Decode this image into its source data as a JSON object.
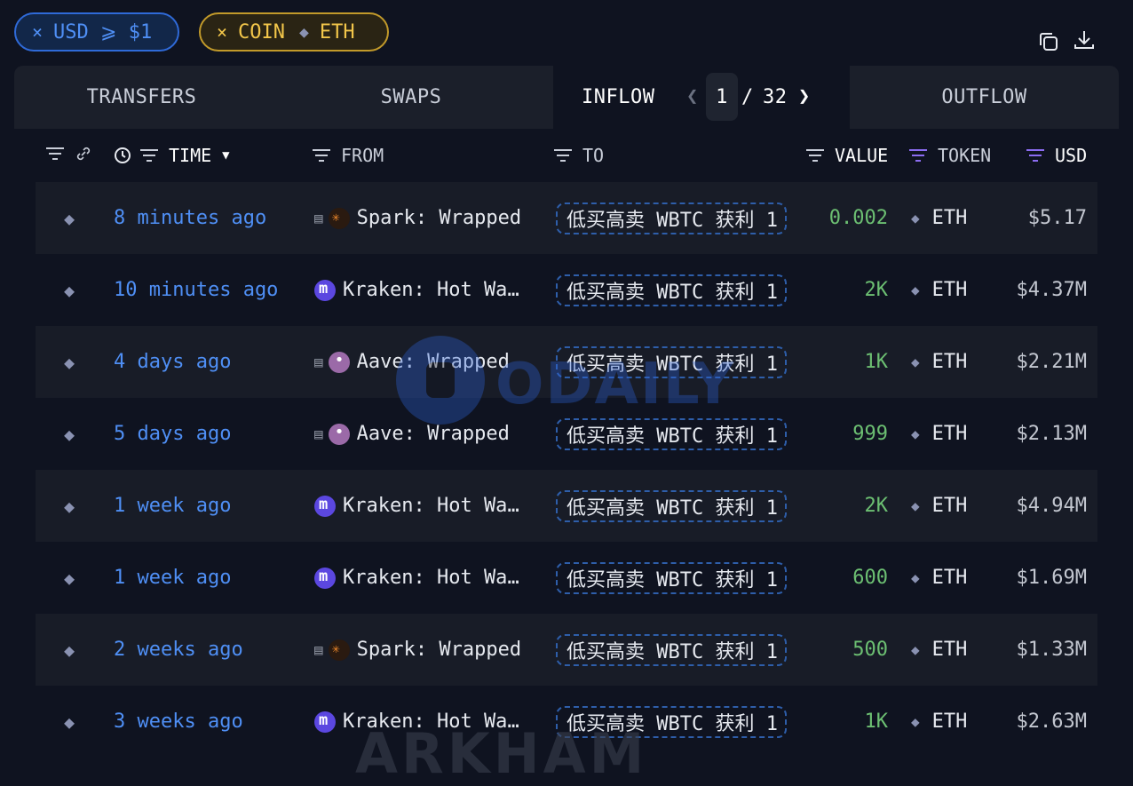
{
  "filters": {
    "usd": {
      "x": "×",
      "label": "USD ⩾ $1"
    },
    "coin": {
      "x": "×",
      "label": "COIN",
      "value": "ETH"
    }
  },
  "toolbar": {
    "copy_icon": "copy-icon",
    "download_icon": "download-icon"
  },
  "tabs": {
    "transfers": "TRANSFERS",
    "swaps": "SWAPS",
    "inflow": "INFLOW",
    "outflow": "OUTFLOW",
    "page_current": "1",
    "page_sep": "/",
    "page_total": "32"
  },
  "columns": {
    "time": "TIME",
    "from": "FROM",
    "to": "TO",
    "value": "VALUE",
    "token": "TOKEN",
    "usd": "USD"
  },
  "colors": {
    "accent_blue": "#4f8ff5",
    "value_green": "#6cbf72",
    "filter_purple": "#8b6cf0",
    "coin_gold": "#f2c64a"
  },
  "rows": [
    {
      "time": "8 minutes ago",
      "from": "Spark: Wrapped",
      "from_icon": "spark",
      "to": "低买高卖 WBTC 获利 1",
      "value": "0.002",
      "token": "ETH",
      "usd": "$5.17"
    },
    {
      "time": "10 minutes ago",
      "from": "Kraken: Hot Wallet",
      "from_icon": "kraken",
      "to": "低买高卖 WBTC 获利 1",
      "value": "2K",
      "token": "ETH",
      "usd": "$4.37M"
    },
    {
      "time": "4 days ago",
      "from": "Aave: Wrapped",
      "from_icon": "aave",
      "to": "低买高卖 WBTC 获利 1",
      "value": "1K",
      "token": "ETH",
      "usd": "$2.21M"
    },
    {
      "time": "5 days ago",
      "from": "Aave: Wrapped",
      "from_icon": "aave",
      "to": "低买高卖 WBTC 获利 1",
      "value": "999",
      "token": "ETH",
      "usd": "$2.13M"
    },
    {
      "time": "1 week ago",
      "from": "Kraken: Hot Wallet",
      "from_icon": "kraken",
      "to": "低买高卖 WBTC 获利 1",
      "value": "2K",
      "token": "ETH",
      "usd": "$4.94M"
    },
    {
      "time": "1 week ago",
      "from": "Kraken: Hot Wallet",
      "from_icon": "kraken",
      "to": "低买高卖 WBTC 获利 1",
      "value": "600",
      "token": "ETH",
      "usd": "$1.69M"
    },
    {
      "time": "2 weeks ago",
      "from": "Spark: Wrapped",
      "from_icon": "spark",
      "to": "低买高卖 WBTC 获利 1",
      "value": "500",
      "token": "ETH",
      "usd": "$1.33M"
    },
    {
      "time": "3 weeks ago",
      "from": "Kraken: Hot Wallet",
      "from_icon": "kraken",
      "to": "低买高卖 WBTC 获利 1",
      "value": "1K",
      "token": "ETH",
      "usd": "$2.63M"
    }
  ],
  "watermarks": {
    "top": "ODAILY",
    "bottom": "ARKHAM"
  }
}
